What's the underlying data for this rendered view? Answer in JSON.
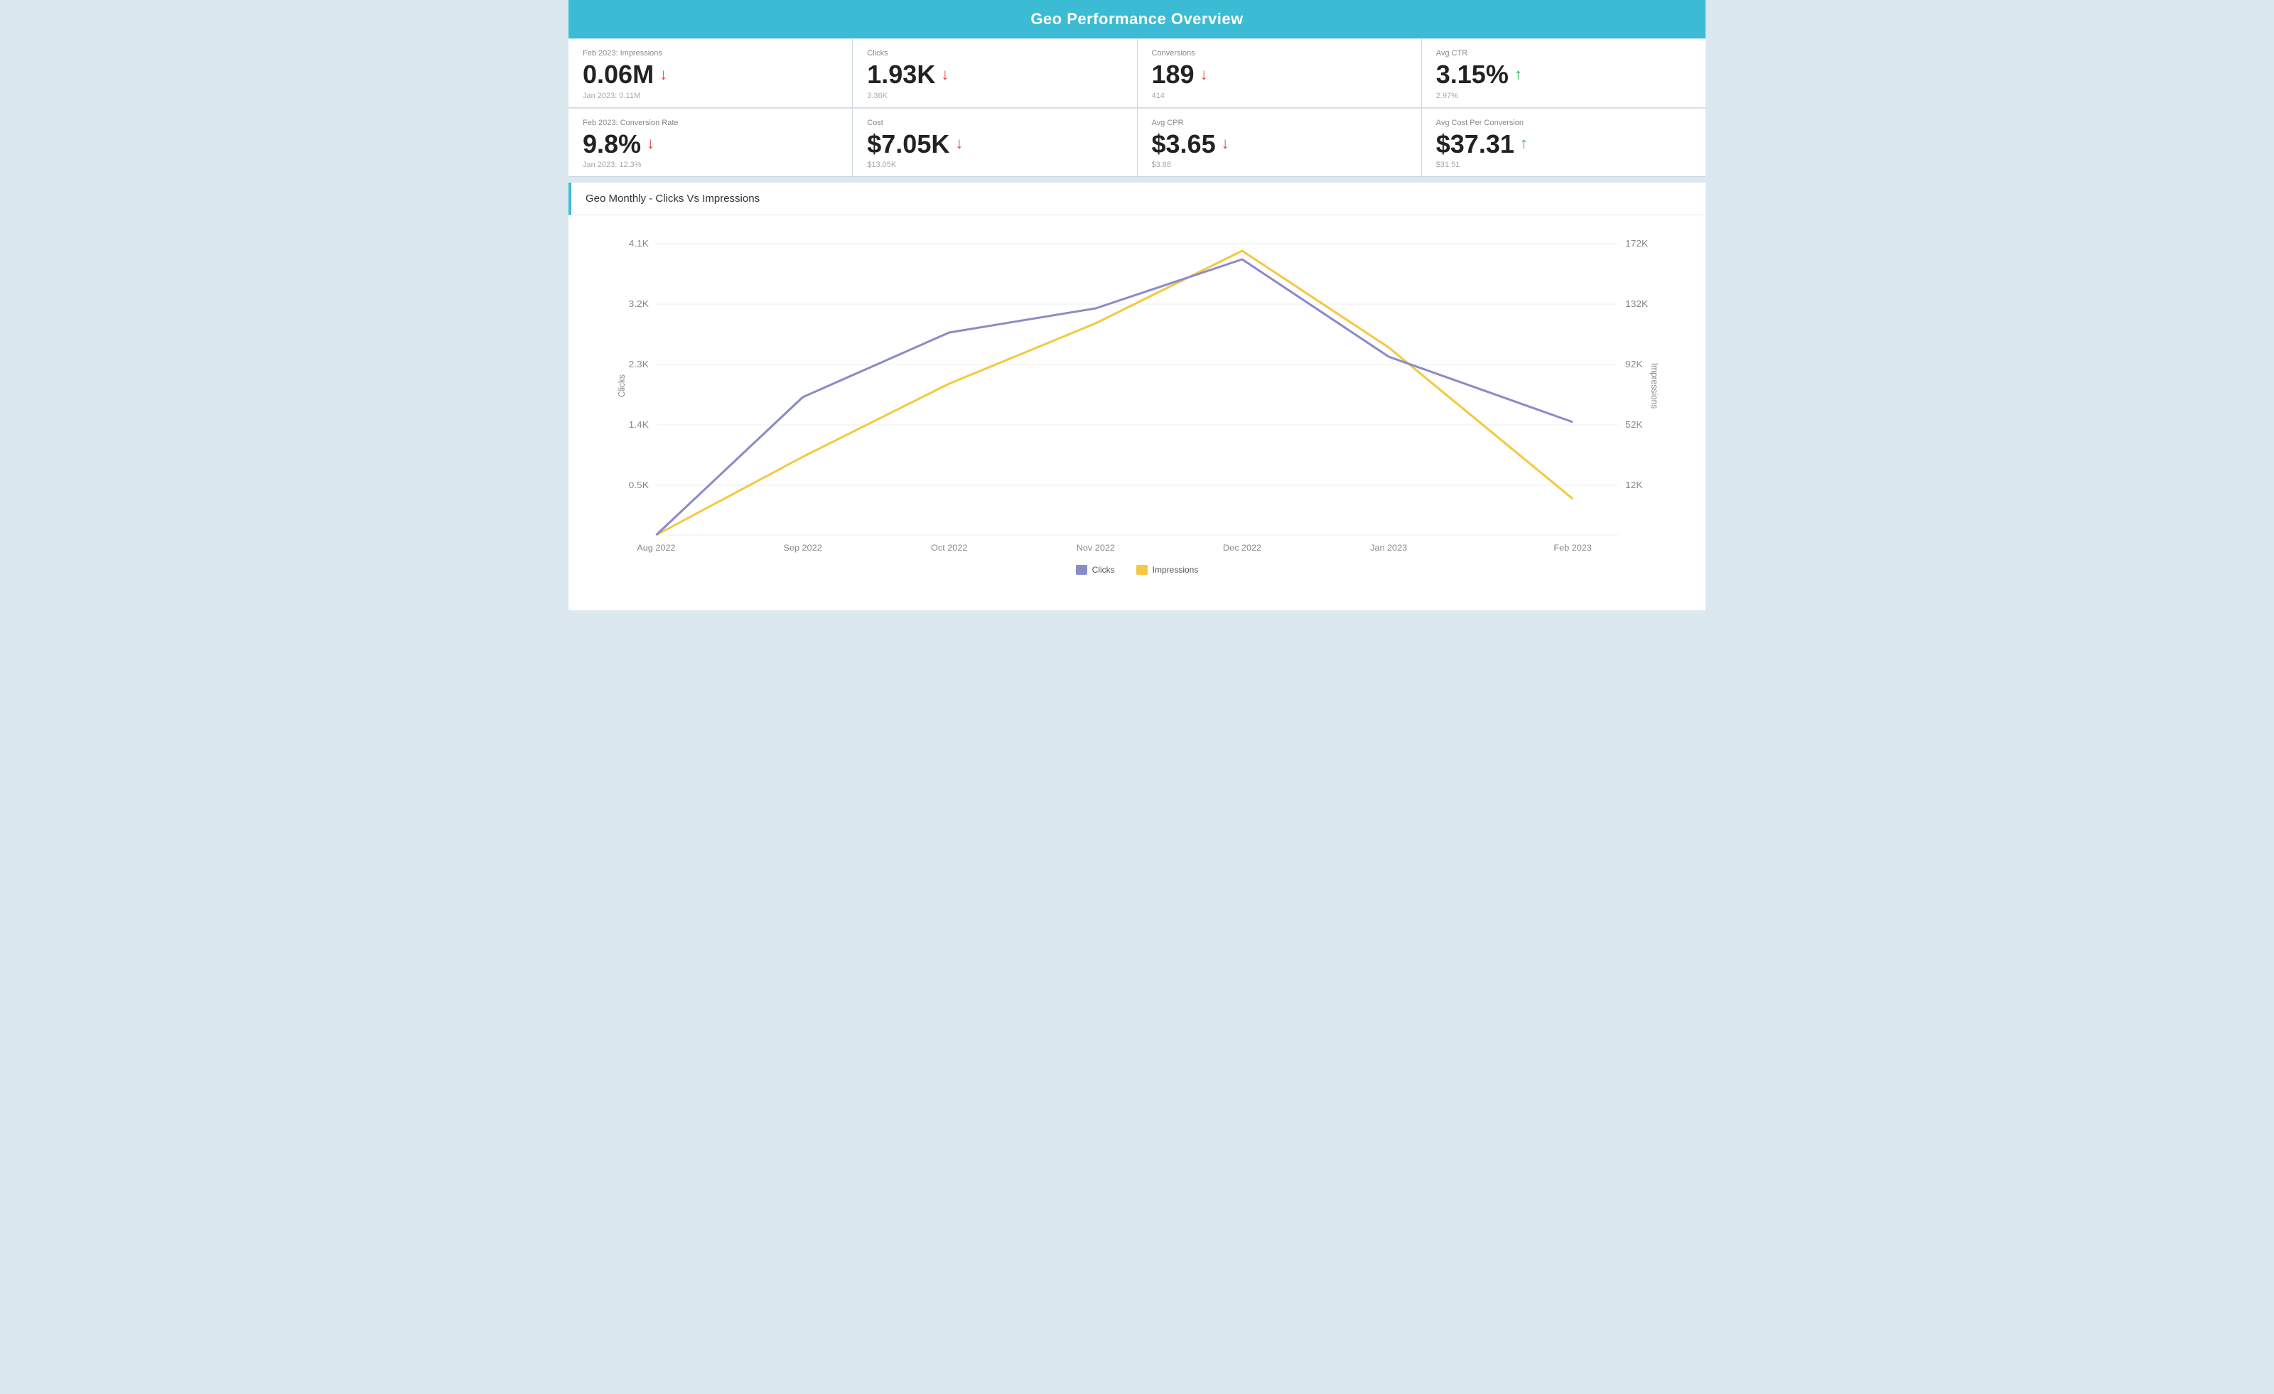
{
  "header": {
    "title": "Geo Performance Overview"
  },
  "metrics_row1": [
    {
      "label": "Feb 2023: Impressions",
      "value": "0.06M",
      "direction": "down",
      "prev": "Jan 2023: 0.11M"
    },
    {
      "label": "Clicks",
      "value": "1.93K",
      "direction": "down",
      "prev": "3.36K"
    },
    {
      "label": "Conversions",
      "value": "189",
      "direction": "down",
      "prev": "414"
    },
    {
      "label": "Avg CTR",
      "value": "3.15%",
      "direction": "up",
      "prev": "2.97%"
    }
  ],
  "metrics_row2": [
    {
      "label": "Feb 2023: Conversion Rate",
      "value": "9.8%",
      "direction": "down",
      "prev": "Jan 2023: 12.3%"
    },
    {
      "label": "Cost",
      "value": "$7.05K",
      "direction": "down",
      "prev": "$13.05K"
    },
    {
      "label": "Avg CPR",
      "value": "$3.65",
      "direction": "down",
      "prev": "$3.88"
    },
    {
      "label": "Avg Cost Per Conversion",
      "value": "$37.31",
      "direction": "up",
      "prev": "$31.51"
    }
  ],
  "chart": {
    "title": "Geo Monthly - Clicks Vs Impressions",
    "x_labels": [
      "Aug 2022",
      "Sep 2022",
      "Oct 2022",
      "Nov 2022",
      "Dec 2022",
      "Jan 2023",
      "Feb 2023"
    ],
    "y_left_labels": [
      "0.5K",
      "1.4K",
      "2.3K",
      "3.2K",
      "4.1K"
    ],
    "y_right_labels": [
      "12K",
      "52K",
      "92K",
      "132K",
      "172K"
    ],
    "y_left_axis": "Clicks",
    "y_right_axis": "Impressions",
    "legend": [
      {
        "label": "Clicks",
        "color": "clicks"
      },
      {
        "label": "Impressions",
        "color": "impressions"
      }
    ]
  }
}
